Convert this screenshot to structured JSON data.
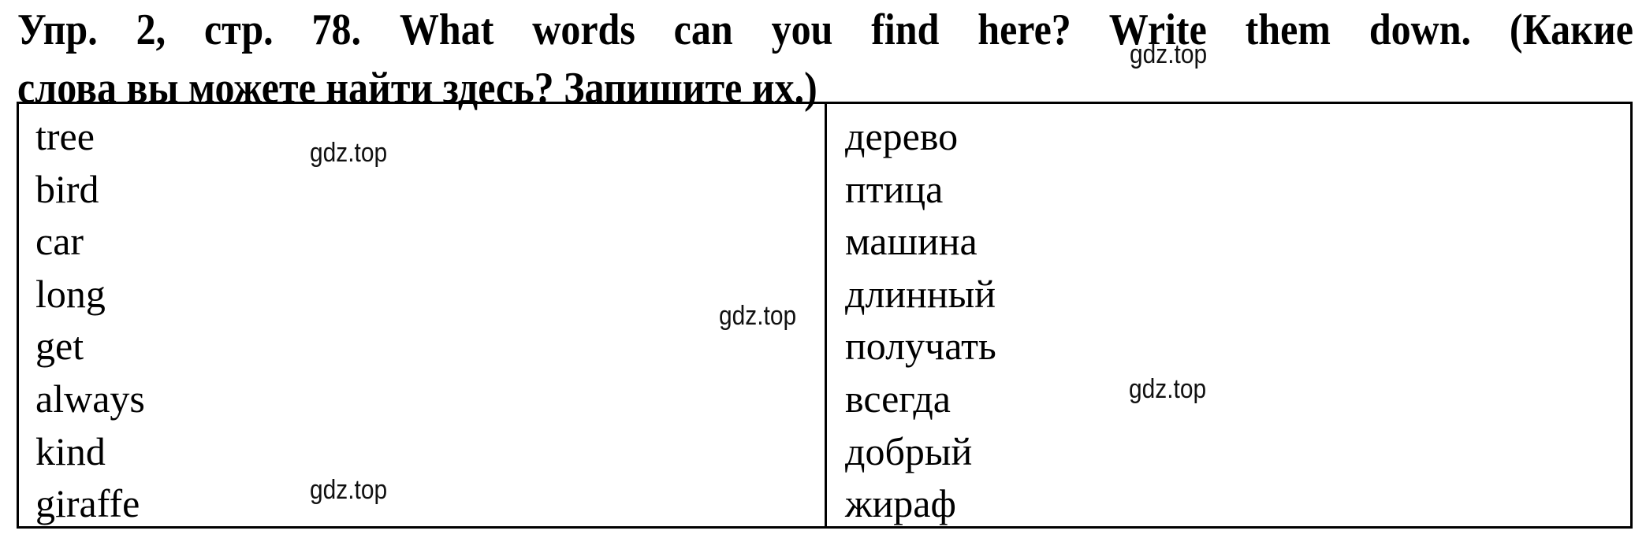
{
  "exercise": {
    "title_line1": "Упр. 2, стр. 78. What words can you find here? Write them down. (Какие",
    "title_line2": "слова вы можете найти здесь? Запишите их.)"
  },
  "table": {
    "rows": [
      {
        "english": "tree",
        "russian": "дерево"
      },
      {
        "english": "bird",
        "russian": "птица"
      },
      {
        "english": "car",
        "russian": "машина"
      },
      {
        "english": "long",
        "russian": "длинный"
      },
      {
        "english": "get",
        "russian": "получать"
      },
      {
        "english": "always",
        "russian": "всегда"
      },
      {
        "english": "kind",
        "russian": "добрый"
      },
      {
        "english": "giraffe",
        "russian": "жираф"
      }
    ]
  },
  "watermarks": [
    "gdz.top",
    "gdz.top",
    "gdz.top",
    "gdz.top",
    "gdz.top"
  ]
}
